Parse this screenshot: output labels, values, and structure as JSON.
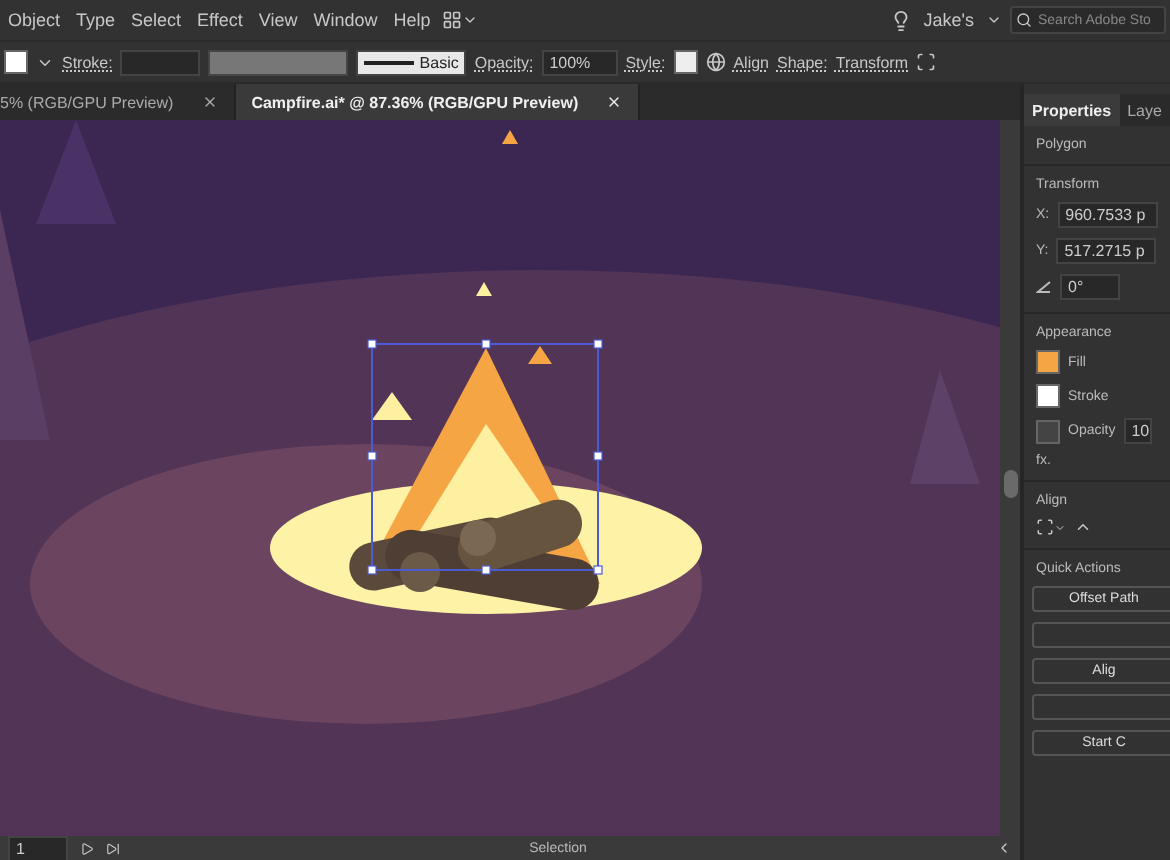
{
  "menu_bar": {
    "items": [
      "Object",
      "Type",
      "Select",
      "Effect",
      "View",
      "Window",
      "Help"
    ],
    "account": "Jake's",
    "search": {
      "placeholder": "Search Adobe Sto"
    }
  },
  "control_bar": {
    "stroke_label": "Stroke:",
    "profile": "Basic",
    "opacity_label": "Opacity:",
    "opacity": "100%",
    "style_label": "Style:",
    "align": "Align",
    "shape": "Shape:",
    "transform": "Transform"
  },
  "document_tabs": [
    {
      "label": "5% (RGB/GPU Preview)",
      "selected": false
    },
    {
      "label": "Campfire.ai* @ 87.36% (RGB/GPU Preview)",
      "selected": true
    }
  ],
  "panel": {
    "tabs": [
      {
        "label": "Properties",
        "selected": true
      },
      {
        "label": "Laye",
        "selected": false
      }
    ],
    "object_type": "Polygon",
    "transform": {
      "title": "Transform",
      "x_label": "X:",
      "x": "960.7533 p",
      "y_label": "Y:",
      "y": "517.2715 p",
      "angle": "0°"
    },
    "appearance": {
      "title": "Appearance",
      "fill": "Fill",
      "stroke": "Stroke",
      "opacity": "Opacity",
      "opacity_value": "10",
      "fx": "fx."
    },
    "align": {
      "title": "Align"
    },
    "quick_actions": {
      "title": "Quick Actions",
      "buttons": [
        {
          "kind": "labeled",
          "label": "Offset Path"
        },
        {
          "kind": "blank"
        },
        {
          "kind": "labeled",
          "label": "Alig"
        },
        {
          "kind": "blank"
        },
        {
          "kind": "labeled",
          "label": "Start C"
        }
      ]
    }
  },
  "status_bar": {
    "page": "1",
    "tool": "Selection"
  }
}
